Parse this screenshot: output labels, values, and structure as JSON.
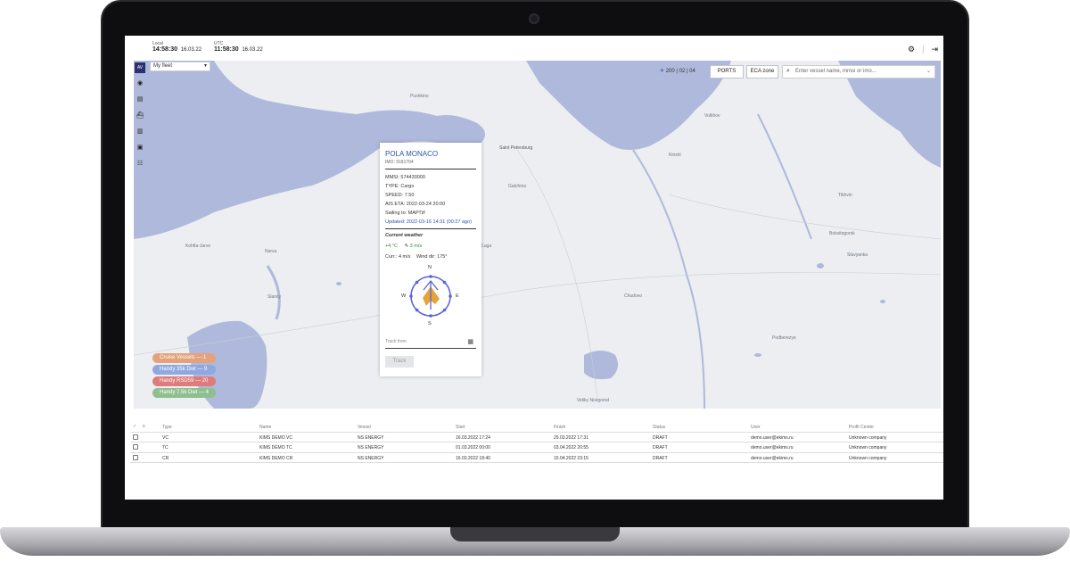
{
  "header": {
    "local_label": "Local",
    "local_time": "14:58:30",
    "local_date": "16.03.22",
    "utc_label": "UTC",
    "utc_time": "11:58:30",
    "utc_date": "16.03.22"
  },
  "toolbar": {
    "active_label": "AV",
    "fleet_value": "My fleet"
  },
  "map": {
    "vessel_counts": "200 | 02 | 04",
    "ports_label": "PORTS",
    "eca_label": "ECA zone",
    "search_placeholder": "Enter vessel name, mmsi or imo...",
    "labels": [
      "Pushkino",
      "Saint Petersburg",
      "Gatchina",
      "Kohtla-Jarve",
      "Narva",
      "Slancy",
      "Luga",
      "Kirishi",
      "Chudovo",
      "Veliky Novgorod",
      "Podberezye",
      "Slavyanka",
      "Volkhov",
      "Tikhvin",
      "Boksitogorsk"
    ],
    "water_color": "#aeb9dc",
    "land_color": "#eceef1"
  },
  "legend": [
    {
      "label": "Cruise Vessels — 1",
      "color": "#e4a27a"
    },
    {
      "label": "Handy 35k Dwt — 9",
      "color": "#8fa9e0"
    },
    {
      "label": "Handy RSD59 — 20",
      "color": "#e07b7b"
    },
    {
      "label": "Handy 7.5k Dwt — 4",
      "color": "#8fbf8f"
    }
  ],
  "popup": {
    "vessel_name": "POLA MONACO",
    "imo": "IMO: 9181704",
    "mmsi": "MMSI: 574430000",
    "type": "TYPE: Cargo",
    "speed": "SPEED: 7.50",
    "ais_eta": "AIS ETA: 2022-03-24 20:00",
    "sailing_to": "Sailing to: МАРТИ",
    "updated": "Updated: 2022-03-16 14:31 (00:27 ago)",
    "weather_title": "Current weather",
    "temperature": "+4 °C",
    "wind": "3 m/s",
    "current": "Curr.: 4 m/s",
    "wind_dir": "Wind dir: 175°",
    "compass": {
      "n": "N",
      "s": "S",
      "w": "W",
      "e": "E"
    },
    "track_placeholder": "Track from",
    "track_button": "Track"
  },
  "table": {
    "columns": [
      "Type",
      "Name",
      "Vessel",
      "Start",
      "Finish",
      "Status",
      "User",
      "Profit Center"
    ],
    "rows": [
      [
        "VC",
        "KIMS DEMO VC",
        "NS ENERGY",
        "16.03.2022 17:24",
        "29.03.2022 17:31",
        "DRAFT",
        "demo.user@ekims.ru",
        "Unknown company"
      ],
      [
        "TC",
        "KIMS DEMO TC",
        "NS ENERGY",
        "01.03.2022 00:00",
        "03.04.2022 20:55",
        "DRAFT",
        "demo.user@ekims.ru",
        "Unknown company"
      ],
      [
        "CR",
        "KIMS DEMO CR",
        "NS ENERGY",
        "16.03.2022 18:40",
        "15.04.2022 23:15",
        "DRAFT",
        "demo.user@ekims.ru",
        "Unknown company"
      ]
    ]
  }
}
